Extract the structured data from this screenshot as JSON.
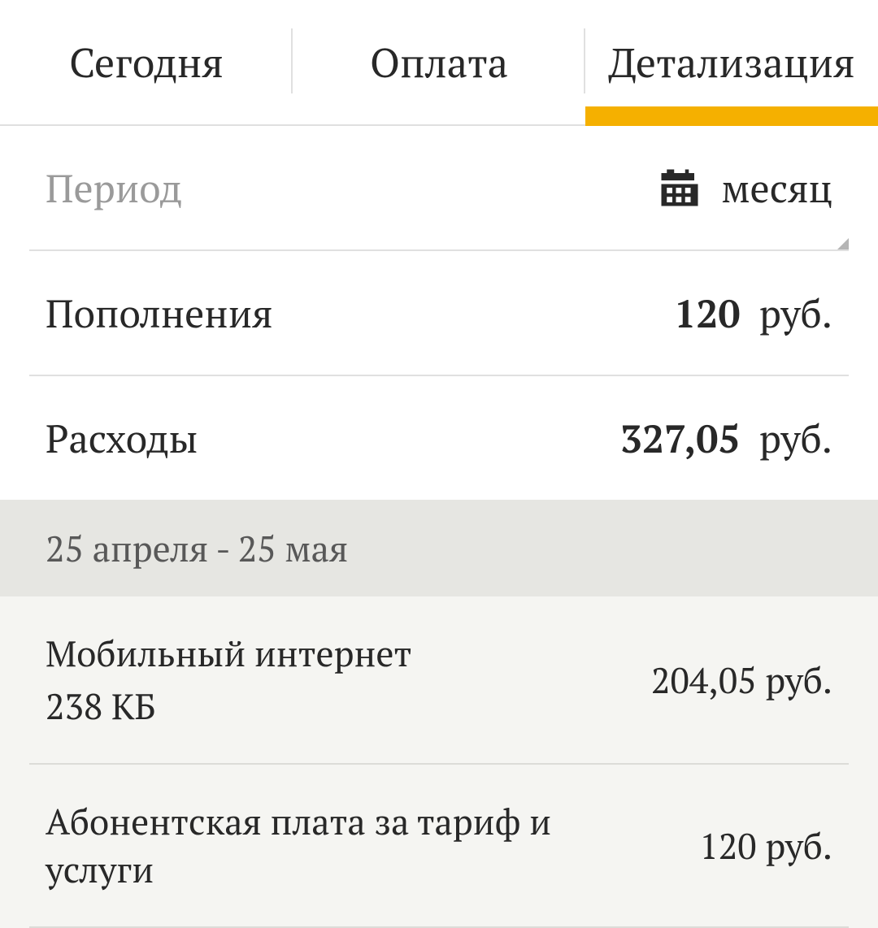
{
  "tabs": {
    "today": "Сегодня",
    "payment": "Оплата",
    "details": "Детализация"
  },
  "period": {
    "label": "Период",
    "value": "месяц"
  },
  "topups": {
    "label": "Пополнения",
    "amount": "120",
    "unit": "руб."
  },
  "expenses": {
    "label": "Расходы",
    "amount": "327,05",
    "unit": "руб."
  },
  "section_range": "25 апреля - 25 мая",
  "items": [
    {
      "title": "Мобильный интернет",
      "subtitle": "238 КБ",
      "amount": "204,05 руб."
    },
    {
      "title": "Абонентская плата за тариф и услуги",
      "subtitle": "",
      "amount": "120 руб."
    }
  ]
}
